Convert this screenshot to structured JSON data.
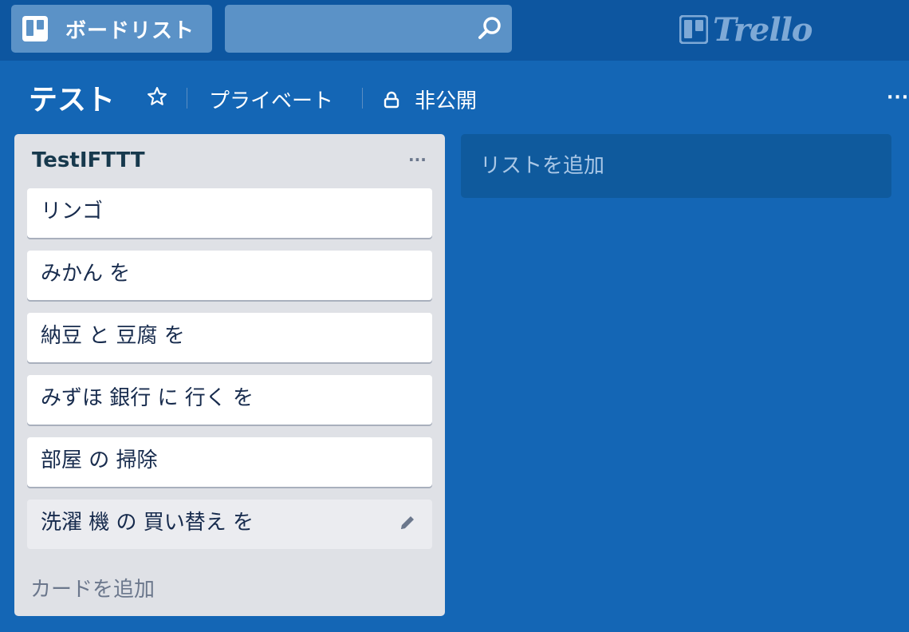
{
  "topbar": {
    "boards_label": "ボードリスト",
    "search_value": "",
    "logo_text": "Trello"
  },
  "board": {
    "title": "テスト",
    "team_label": "プライベート",
    "privacy_label": "非公開"
  },
  "list": {
    "title": "TestIFTTT",
    "cards": [
      {
        "text": "リンゴ"
      },
      {
        "text": "みかん を"
      },
      {
        "text": "納豆 と 豆腐 を"
      },
      {
        "text": "みずほ 銀行 に 行く を"
      },
      {
        "text": "部屋 の 掃除"
      },
      {
        "text": "洗濯 機 の 買い替え を"
      }
    ],
    "add_card_label": "カードを追加"
  },
  "add_list_label": "リストを追加",
  "colors": {
    "board_bg": "#1466b5",
    "topbar_bg": "#0d56a0",
    "list_bg": "#dfe1e6"
  }
}
